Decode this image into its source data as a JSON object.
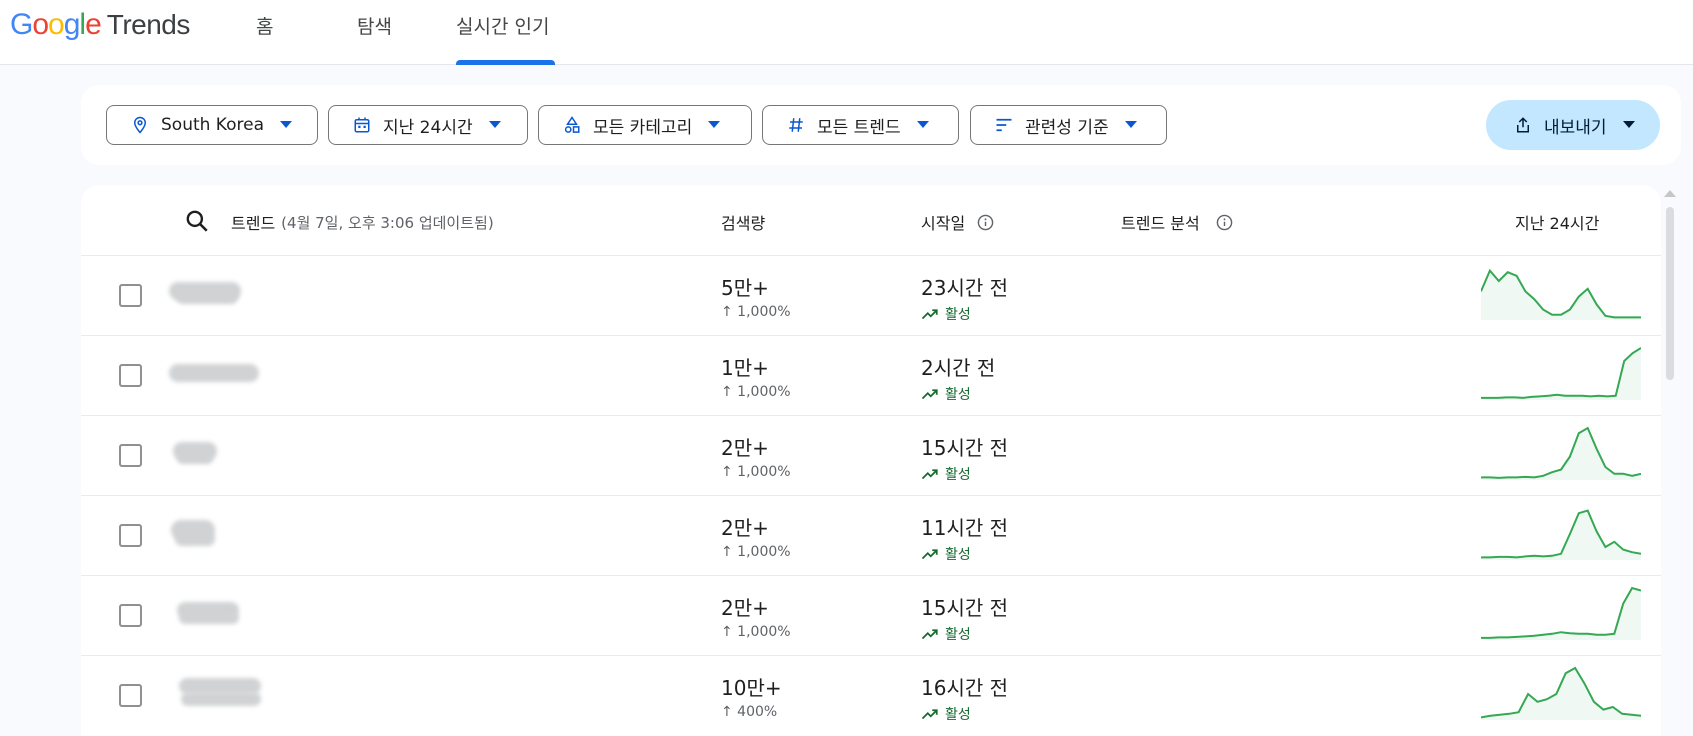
{
  "header": {
    "logo_google": "Google",
    "logo_trends": "Trends",
    "tabs": [
      {
        "label": "홈"
      },
      {
        "label": "탐색"
      },
      {
        "label": "실시간 인기"
      }
    ],
    "active_tab": "실시간 인기"
  },
  "filters": {
    "location": "South Korea",
    "period": "지난 24시간",
    "category": "모든 카테고리",
    "trend_type": "모든 트렌드",
    "sort": "관련성 기준",
    "export": "내보내기"
  },
  "table": {
    "col_trend": "트렌드",
    "col_trend_updated": "(4월 7일, 오후 3:06 업데이트됨)",
    "col_volume": "검색량",
    "col_started": "시작일",
    "col_analysis": "트렌드 분석",
    "col_chart": "지난 24시간",
    "rows": [
      {
        "volume": "5만+",
        "change": "↑ 1,000%",
        "started": "23시간 전",
        "status": "활성",
        "spark": [
          0.55,
          0.95,
          0.75,
          0.92,
          0.85,
          0.55,
          0.4,
          0.2,
          0.1,
          0.1,
          0.2,
          0.45,
          0.6,
          0.3,
          0.08,
          0.05,
          0.05,
          0.05,
          0.05
        ]
      },
      {
        "volume": "1만+",
        "change": "↑ 1,000%",
        "started": "2시간 전",
        "status": "활성",
        "spark": [
          0.04,
          0.04,
          0.04,
          0.05,
          0.05,
          0.04,
          0.06,
          0.07,
          0.08,
          0.1,
          0.08,
          0.08,
          0.08,
          0.07,
          0.08,
          0.07,
          0.08,
          0.75,
          0.9,
          1.0
        ]
      },
      {
        "volume": "2만+",
        "change": "↑ 1,000%",
        "started": "15시간 전",
        "status": "활성",
        "spark": [
          0.05,
          0.05,
          0.04,
          0.05,
          0.05,
          0.06,
          0.05,
          0.08,
          0.15,
          0.2,
          0.45,
          0.9,
          1.0,
          0.6,
          0.25,
          0.12,
          0.12,
          0.08,
          0.12
        ]
      },
      {
        "volume": "2만+",
        "change": "↑ 1,000%",
        "started": "11시간 전",
        "status": "활성",
        "spark": [
          0.05,
          0.05,
          0.06,
          0.06,
          0.05,
          0.07,
          0.08,
          0.07,
          0.08,
          0.12,
          0.5,
          0.9,
          0.95,
          0.55,
          0.25,
          0.35,
          0.2,
          0.15,
          0.12
        ]
      },
      {
        "volume": "2만+",
        "change": "↑ 1,000%",
        "started": "15시간 전",
        "status": "활성",
        "spark": [
          0.04,
          0.04,
          0.05,
          0.05,
          0.06,
          0.07,
          0.08,
          0.1,
          0.12,
          0.15,
          0.13,
          0.12,
          0.12,
          0.1,
          0.1,
          0.12,
          0.7,
          1.0,
          0.95
        ]
      },
      {
        "volume": "10만+",
        "change": "↑ 400%",
        "started": "16시간 전",
        "status": "활성",
        "spark": [
          0.05,
          0.08,
          0.1,
          0.12,
          0.15,
          0.5,
          0.35,
          0.4,
          0.5,
          0.9,
          1.0,
          0.7,
          0.35,
          0.2,
          0.25,
          0.12,
          0.1,
          0.08
        ]
      }
    ]
  },
  "colors": {
    "accent": "#1a73e8",
    "export_bg": "#c2e7ff",
    "spark_line": "#34a853",
    "active_text": "#146c2e"
  }
}
